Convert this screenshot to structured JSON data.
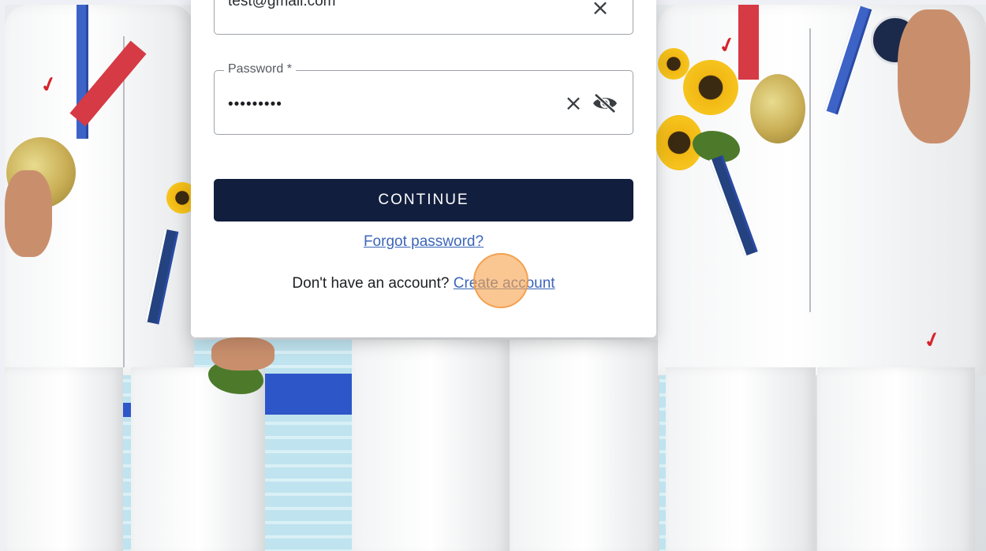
{
  "login": {
    "email_value": "test@gmail.com",
    "password_label": "Password *",
    "password_value": "•••••••••",
    "clear_icon": "×",
    "continue_label": "CONTINUE",
    "forgot_label": "Forgot password?",
    "signup_prompt": "Don't have an account?",
    "create_account_label": "Create account"
  },
  "icons": {
    "email_clear": "close-icon",
    "password_clear": "close-icon",
    "password_visibility": "eye-off-icon"
  },
  "colors": {
    "primary_button": "#121e3d",
    "link": "#3c66b8",
    "click_indicator": "#f7a450"
  }
}
